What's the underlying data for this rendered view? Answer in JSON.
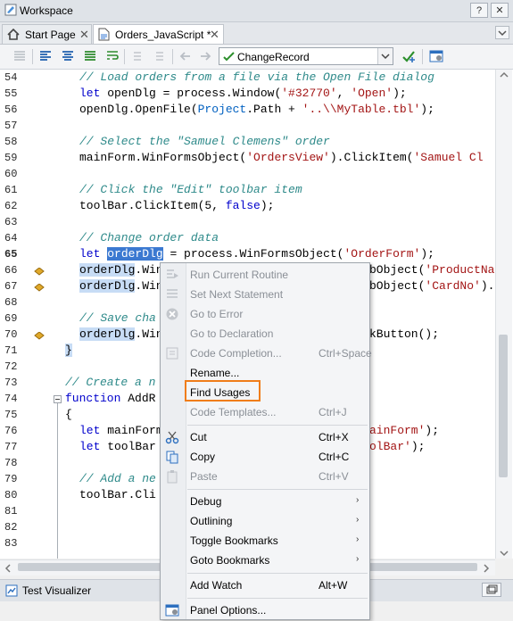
{
  "window": {
    "title": "Workspace",
    "help_btn": "?",
    "close_btn": "✕"
  },
  "tabs": [
    {
      "label": "Start Page",
      "close": "✕"
    },
    {
      "label": "Orders_JavaScript *",
      "close": "✕"
    }
  ],
  "toolbar": {
    "routine_value": "ChangeRecord"
  },
  "editor": {
    "lines": [
      "54",
      "55",
      "56",
      "57",
      "58",
      "59",
      "60",
      "61",
      "62",
      "63",
      "64",
      "65",
      "66",
      "67",
      "68",
      "69",
      "70",
      "71",
      "72",
      "73",
      "74",
      "75",
      "76",
      "77",
      "78",
      "79",
      "80",
      "81",
      "82",
      "83"
    ],
    "code": {
      "l54": "// Load orders from a file via the Open File dialog",
      "l55a": "let",
      "l55b": " openDlg = process.Window(",
      "l55c": "'#32770'",
      "l55d": ", ",
      "l55e": "'Open'",
      "l55f": ");",
      "l56a": "openDlg.OpenFile(",
      "l56b": "Project",
      "l56c": ".Path + ",
      "l56d": "'..\\\\MyTable.tbl'",
      "l56e": ");",
      "l58": "// Select the \"Samuel Clemens\" order",
      "l59a": "mainForm.WinFormsObject(",
      "l59b": "'OrdersView'",
      "l59c": ").ClickItem(",
      "l59d": "'Samuel Cl",
      "l61": "// Click the \"Edit\" toolbar item",
      "l62a": "toolBar.ClickItem(5, ",
      "l62b": "false",
      "l62c": ");",
      "l64": "// Change order data",
      "l65a": "let",
      "l65b": "orderDlg",
      "l65c": " = process.WinFormsObject(",
      "l65d": "'OrderForm'",
      "l65e": ");",
      "l66a": "orderDlg",
      "l66b": ".Win",
      "l66c": "bObject(",
      "l66d": "'ProductNa",
      "l67a": "orderDlg",
      "l67b": ".Win",
      "l67c": "bObject(",
      "l67d": "'CardNo'",
      "l67e": ").",
      "l69": "// Save cha",
      "l70a": "orderDlg",
      "l70b": ".Win",
      "l70c": "kButton();",
      "l71": "}",
      "l73": "// Create a n",
      "l74a": "function",
      "l74b": " AddR",
      "l75": "{",
      "l76a": "let",
      "l76b": " mainForm",
      "l76c": "ainForm'",
      "l76d": ");",
      "l77a": "let",
      "l77b": " toolBar",
      "l77c": "olBar'",
      "l77d": ");",
      "l79": "// Add a ne",
      "l80a": "toolBar.Cli"
    }
  },
  "bottom_panel": {
    "label": "Test Visualizer"
  },
  "context_menu": {
    "items": [
      {
        "label": "Run Current Routine",
        "shortcut": "",
        "disabled": true
      },
      {
        "label": "Set Next Statement",
        "shortcut": "",
        "disabled": true
      },
      {
        "label": "Go to Error",
        "shortcut": "",
        "disabled": true
      },
      {
        "label": "Go to Declaration",
        "shortcut": "",
        "disabled": true
      },
      {
        "label": "Code Completion...",
        "shortcut": "Ctrl+Space",
        "disabled": true
      },
      {
        "label": "Rename...",
        "shortcut": "",
        "disabled": false
      },
      {
        "label": "Find Usages",
        "shortcut": "",
        "disabled": false
      },
      {
        "label": "Code Templates...",
        "shortcut": "Ctrl+J",
        "disabled": true
      },
      {
        "label": "Cut",
        "shortcut": "Ctrl+X",
        "disabled": false
      },
      {
        "label": "Copy",
        "shortcut": "Ctrl+C",
        "disabled": false
      },
      {
        "label": "Paste",
        "shortcut": "Ctrl+V",
        "disabled": true
      },
      {
        "label": "Debug",
        "shortcut": "",
        "disabled": false,
        "submenu": "›"
      },
      {
        "label": "Outlining",
        "shortcut": "",
        "disabled": false,
        "submenu": "›"
      },
      {
        "label": "Toggle Bookmarks",
        "shortcut": "",
        "disabled": false,
        "submenu": "›"
      },
      {
        "label": "Goto Bookmarks",
        "shortcut": "",
        "disabled": false,
        "submenu": "›"
      },
      {
        "label": "Add Watch",
        "shortcut": "Alt+W",
        "disabled": false
      },
      {
        "label": "Panel Options...",
        "shortcut": "",
        "disabled": false
      }
    ]
  },
  "colors": {
    "highlight_border": "#f07d1a",
    "selection": "#3b79d1",
    "comment": "#2e8a8a",
    "keyword": "#0000cc",
    "string": "#a31515"
  }
}
